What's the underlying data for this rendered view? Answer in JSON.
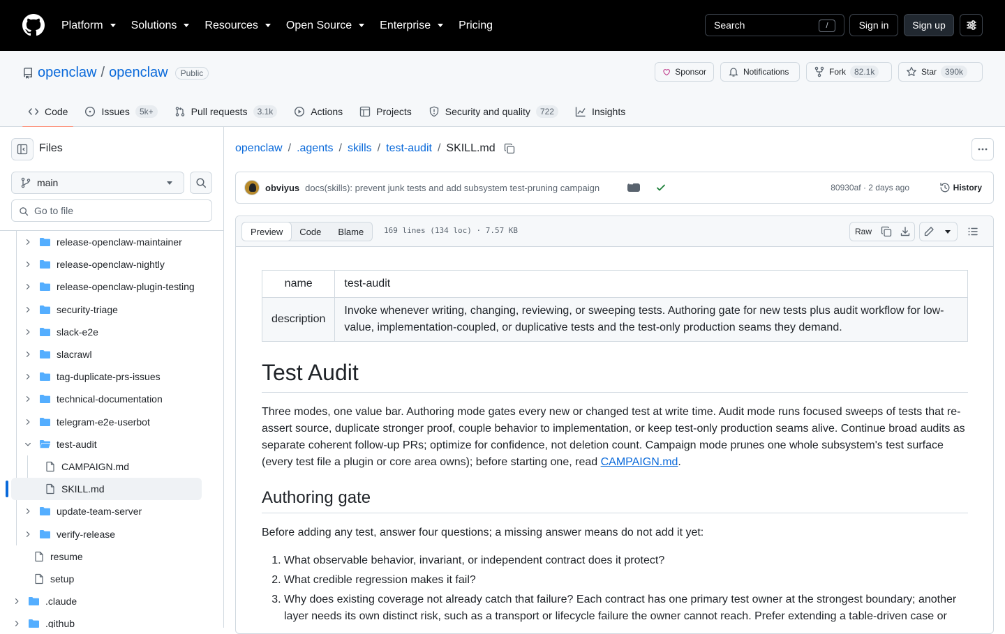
{
  "header": {
    "nav": [
      "Platform",
      "Solutions",
      "Resources",
      "Open Source",
      "Enterprise",
      "Pricing"
    ],
    "search_label": "Search",
    "search_key": "/",
    "signin": "Sign in",
    "signup": "Sign up"
  },
  "repo": {
    "owner": "openclaw",
    "name": "openclaw",
    "visibility": "Public",
    "sponsor": "Sponsor",
    "notifications": "Notifications",
    "fork": "Fork",
    "fork_count": "82.1k",
    "star": "Star",
    "star_count": "390k"
  },
  "tabs": [
    {
      "label": "Code",
      "count": null,
      "icon": "code-icon"
    },
    {
      "label": "Issues",
      "count": "5k+",
      "icon": "issue-icon"
    },
    {
      "label": "Pull requests",
      "count": "3.1k",
      "icon": "pull-request-icon"
    },
    {
      "label": "Actions",
      "count": null,
      "icon": "play-icon"
    },
    {
      "label": "Projects",
      "count": null,
      "icon": "table-icon"
    },
    {
      "label": "Security and quality",
      "count": "722",
      "icon": "shield-icon"
    },
    {
      "label": "Insights",
      "count": null,
      "icon": "graph-icon"
    }
  ],
  "sidebar": {
    "title": "Files",
    "branch": "main",
    "goto_placeholder": "Go to file",
    "tree": [
      {
        "name": "release-openclaw-maintainer",
        "type": "folder"
      },
      {
        "name": "release-openclaw-nightly",
        "type": "folder"
      },
      {
        "name": "release-openclaw-plugin-testing",
        "type": "folder"
      },
      {
        "name": "security-triage",
        "type": "folder"
      },
      {
        "name": "slack-e2e",
        "type": "folder"
      },
      {
        "name": "slacrawl",
        "type": "folder"
      },
      {
        "name": "tag-duplicate-prs-issues",
        "type": "folder"
      },
      {
        "name": "technical-documentation",
        "type": "folder"
      },
      {
        "name": "telegram-e2e-userbot",
        "type": "folder"
      },
      {
        "name": "test-audit",
        "type": "folder-open"
      },
      {
        "name": "CAMPAIGN.md",
        "type": "file"
      },
      {
        "name": "SKILL.md",
        "type": "file",
        "selected": true
      },
      {
        "name": "update-team-server",
        "type": "folder"
      },
      {
        "name": "verify-release",
        "type": "folder"
      },
      {
        "name": "resume",
        "type": "file"
      },
      {
        "name": "setup",
        "type": "file"
      },
      {
        "name": ".claude",
        "type": "folder"
      },
      {
        "name": ".github",
        "type": "folder"
      }
    ]
  },
  "breadcrumb": {
    "parts": [
      "openclaw",
      ".agents",
      "skills",
      "test-audit"
    ],
    "file": "SKILL.md"
  },
  "commit": {
    "author": "obviyus",
    "message": "docs(skills): prevent junk tests and add subsystem test-pruning campaign",
    "sha_time": "80930af · 2 days ago",
    "history": "History"
  },
  "file": {
    "view_tabs": [
      "Preview",
      "Code",
      "Blame"
    ],
    "info": "169 lines (134 loc) · 7.57 KB",
    "raw": "Raw"
  },
  "doc": {
    "meta": [
      {
        "k": "name",
        "v": "test-audit"
      },
      {
        "k": "description",
        "v": "Invoke whenever writing, changing, reviewing, or sweeping tests. Authoring gate for new tests plus audit workflow for low-value, implementation-coupled, or duplicative tests and the test-only production seams they demand."
      }
    ],
    "h1": "Test Audit",
    "intro": "Three modes, one value bar. Authoring mode gates every new or changed test at write time. Audit mode runs focused sweeps of tests that re-assert source, duplicate stronger proof, couple behavior to implementation, or keep test-only production seams alive. Continue broad audits as separate coherent follow-up PRs; optimize for confidence, not deletion count. Campaign mode prunes one whole subsystem's test surface (every test file a plugin or core area owns); before starting one, read ",
    "intro_link": "CAMPAIGN.md",
    "intro_end": ".",
    "h2": "Authoring gate",
    "gate_intro": "Before adding any test, answer four questions; a missing answer means do not add it yet:",
    "questions": [
      "What observable behavior, invariant, or independent contract does it protect?",
      "What credible regression makes it fail?",
      "Why does existing coverage not already catch that failure? Each contract has one primary test owner at the strongest boundary; another layer needs its own distinct risk, such as a transport or lifecycle failure the owner cannot reach. Prefer extending a table-driven case or"
    ]
  },
  "colors": {
    "accent": "#0969da",
    "tab_underline": "#fd8c73",
    "success": "#1a7f37"
  }
}
